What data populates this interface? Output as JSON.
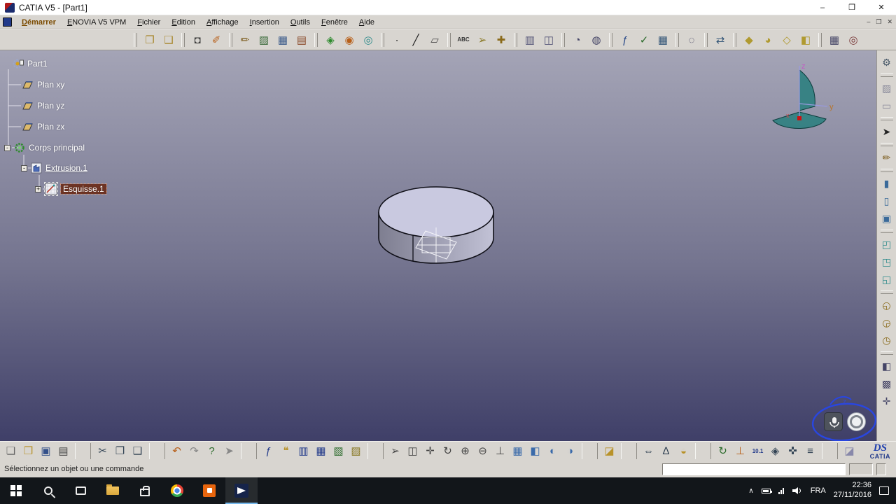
{
  "window": {
    "title": "CATIA V5 - [Part1]",
    "controls": [
      {
        "name": "minimize-button",
        "glyph": "–"
      },
      {
        "name": "maximize-button",
        "glyph": "❒"
      },
      {
        "name": "close-button",
        "glyph": "✕"
      }
    ],
    "mdi_controls": [
      {
        "name": "mdi-minimize-button",
        "glyph": "–"
      },
      {
        "name": "mdi-restore-button",
        "glyph": "❐"
      },
      {
        "name": "mdi-close-button",
        "glyph": "✕"
      }
    ]
  },
  "menu": {
    "items": [
      {
        "label": "Démarrer",
        "name": "menu-demarrer",
        "cls": "accent"
      },
      {
        "label": "ENOVIA V5 VPM",
        "name": "menu-enovia-v5-vpm"
      },
      {
        "label": "Fichier",
        "name": "menu-fichier"
      },
      {
        "label": "Edition",
        "name": "menu-edition"
      },
      {
        "label": "Affichage",
        "name": "menu-affichage"
      },
      {
        "label": "Insertion",
        "name": "menu-insertion"
      },
      {
        "label": "Outils",
        "name": "menu-outils"
      },
      {
        "label": "Fenêtre",
        "name": "menu-fenetre"
      },
      {
        "label": "Aide",
        "name": "menu-aide"
      }
    ]
  },
  "top_toolbar": {
    "icons": [
      {
        "cls": "sep",
        "name": "toolbar-handle"
      },
      {
        "name": "copy-view-icon",
        "glyph": "❐",
        "color": "#a8862a"
      },
      {
        "name": "paste-view-icon",
        "glyph": "❑",
        "color": "#a8862a"
      },
      {
        "cls": "sep",
        "name": "toolbar-handle"
      },
      {
        "name": "capture-icon",
        "glyph": "◘",
        "color": "#3a3a3a"
      },
      {
        "name": "paint-icon",
        "glyph": "✐",
        "color": "#b8601a"
      },
      {
        "cls": "sep",
        "name": "toolbar-handle"
      },
      {
        "name": "sketch-tracer-icon",
        "glyph": "✏",
        "color": "#7a5a1a"
      },
      {
        "name": "photo-studio-icon",
        "glyph": "▨",
        "color": "#3a6a3a"
      },
      {
        "name": "render-icon",
        "glyph": "▦",
        "color": "#3a5a8a"
      },
      {
        "name": "material-icon",
        "glyph": "▤",
        "color": "#8a4a2a"
      },
      {
        "cls": "sep",
        "name": "toolbar-handle"
      },
      {
        "name": "part-design-icon",
        "glyph": "◈",
        "color": "#2e8b2e"
      },
      {
        "name": "assembly-icon",
        "glyph": "◉",
        "color": "#b8601a"
      },
      {
        "name": "generative-shape-icon",
        "glyph": "◎",
        "color": "#2e8b8b"
      },
      {
        "cls": "sep",
        "name": "toolbar-handle"
      },
      {
        "name": "point-icon",
        "glyph": "∙",
        "color": "#1a1a1a"
      },
      {
        "name": "line-icon",
        "glyph": "╱",
        "color": "#1a1a1a"
      },
      {
        "name": "plane-tool-icon",
        "glyph": "▱",
        "color": "#4a4a4a"
      },
      {
        "cls": "sep",
        "name": "toolbar-handle"
      },
      {
        "name": "text-annotation-icon",
        "glyph": "ABC",
        "color": "#333333",
        "cls": "txt"
      },
      {
        "name": "flag-note-icon",
        "glyph": "➢",
        "color": "#887722"
      },
      {
        "name": "weld-feature-icon",
        "glyph": "✚",
        "color": "#8a6a1a"
      },
      {
        "cls": "sep",
        "name": "toolbar-handle"
      },
      {
        "name": "clash-icon",
        "glyph": "▥",
        "color": "#555577"
      },
      {
        "name": "sectioning-icon",
        "glyph": "◫",
        "color": "#555577"
      },
      {
        "cls": "sep",
        "name": "toolbar-handle"
      },
      {
        "name": "constraints-icon",
        "glyph": "◔",
        "color": "#444466"
      },
      {
        "name": "fix-constraint-icon",
        "glyph": "◍",
        "color": "#444466"
      },
      {
        "cls": "sep",
        "name": "toolbar-handle"
      },
      {
        "name": "formula-knowledge-icon",
        "glyph": "ƒ",
        "color": "#2a4a8a"
      },
      {
        "name": "check-icon",
        "glyph": "✓",
        "color": "#2a6a2a"
      },
      {
        "name": "design-table-icon",
        "glyph": "▦",
        "color": "#335577"
      },
      {
        "cls": "sep",
        "name": "toolbar-handle"
      },
      {
        "name": "search-icon",
        "glyph": "◌",
        "color": "#333355"
      },
      {
        "cls": "sep",
        "name": "toolbar-handle"
      },
      {
        "name": "exchange-icon",
        "glyph": "⇄",
        "color": "#335577"
      },
      {
        "cls": "sep",
        "name": "toolbar-handle"
      },
      {
        "name": "iso-view-icon",
        "glyph": "◆",
        "color": "#b09a30"
      },
      {
        "name": "shading-icon",
        "glyph": "◕",
        "color": "#b09a30"
      },
      {
        "name": "wireframe-view-icon",
        "glyph": "◇",
        "color": "#b09a30"
      },
      {
        "name": "cut-view-icon",
        "glyph": "◧",
        "color": "#b09a30"
      },
      {
        "cls": "sep",
        "name": "toolbar-handle"
      },
      {
        "name": "grid-icon",
        "glyph": "▦",
        "color": "#444466"
      },
      {
        "name": "target-icon",
        "glyph": "◎",
        "color": "#7a3a3a"
      }
    ]
  },
  "right_toolbar": {
    "icons": [
      {
        "name": "workbench-icon",
        "glyph": "⚙",
        "color": "#445566"
      },
      {
        "cls": "sep",
        "name": "toolbar-handle"
      },
      {
        "name": "render-style-icon",
        "glyph": "▨",
        "color": "#888899"
      },
      {
        "name": "ruler-icon",
        "glyph": "▭",
        "color": "#888899"
      },
      {
        "cls": "sep",
        "name": "toolbar-handle"
      },
      {
        "name": "select-arrow-icon",
        "glyph": "➤",
        "color": "#222222"
      },
      {
        "cls": "sep",
        "name": "toolbar-handle"
      },
      {
        "name": "sketcher-icon",
        "glyph": "✏",
        "color": "#7a5a1a"
      },
      {
        "cls": "sep",
        "name": "toolbar-handle"
      },
      {
        "name": "pad-icon",
        "glyph": "▮",
        "color": "#3a6a9a"
      },
      {
        "name": "pocket-icon",
        "glyph": "▯",
        "color": "#3a6a9a"
      },
      {
        "name": "shaft-icon",
        "glyph": "▣",
        "color": "#3a6a9a"
      },
      {
        "cls": "sep",
        "name": "toolbar-handle"
      },
      {
        "name": "shell-icon",
        "glyph": "◰",
        "color": "#2e8b8b"
      },
      {
        "name": "thickness-icon",
        "glyph": "◳",
        "color": "#2e8b8b"
      },
      {
        "name": "stiffener-icon",
        "glyph": "◱",
        "color": "#2e8b8b"
      },
      {
        "cls": "sep",
        "name": "toolbar-handle"
      },
      {
        "name": "fillet-icon",
        "glyph": "◵",
        "color": "#8a6a1a"
      },
      {
        "name": "chamfer-icon",
        "glyph": "◶",
        "color": "#8a6a1a"
      },
      {
        "name": "draft-icon",
        "glyph": "◷",
        "color": "#8a6a1a"
      },
      {
        "cls": "sep",
        "name": "toolbar-handle"
      },
      {
        "name": "mirror-icon",
        "glyph": "◧",
        "color": "#444466"
      },
      {
        "name": "pattern-icon",
        "glyph": "▩",
        "color": "#444466"
      },
      {
        "name": "measure-icon",
        "glyph": "✛",
        "color": "#444466"
      }
    ]
  },
  "bottom_toolbar": {
    "icons": [
      {
        "name": "new-document-icon",
        "glyph": "❏",
        "color": "#666666"
      },
      {
        "name": "open-icon",
        "glyph": "❒",
        "color": "#b8922a"
      },
      {
        "name": "save-icon",
        "glyph": "▣",
        "color": "#33508a"
      },
      {
        "name": "print-icon",
        "glyph": "▤",
        "color": "#444444"
      },
      {
        "cls": "sep",
        "name": "toolbar-handle"
      },
      {
        "name": "cut-icon",
        "glyph": "✂",
        "color": "#334455"
      },
      {
        "name": "copy-icon",
        "glyph": "❐",
        "color": "#334455"
      },
      {
        "name": "paste-icon",
        "glyph": "❑",
        "color": "#334455"
      },
      {
        "cls": "sep",
        "name": "toolbar-handle"
      },
      {
        "name": "undo-icon",
        "glyph": "↶",
        "color": "#b8601a"
      },
      {
        "name": "redo-icon",
        "glyph": "↷",
        "color": "#888888"
      },
      {
        "name": "help-icon",
        "glyph": "?",
        "color": "#2a6a2a"
      },
      {
        "name": "whats-this-icon",
        "glyph": "➤",
        "color": "#888888"
      },
      {
        "cls": "sep",
        "name": "toolbar-handle"
      },
      {
        "name": "formula-icon",
        "glyph": "ƒ",
        "color": "#223a8a"
      },
      {
        "name": "comment-icon",
        "glyph": "❝",
        "color": "#b8922a"
      },
      {
        "name": "rule-icon",
        "glyph": "▥",
        "color": "#223a8a"
      },
      {
        "name": "table-icon",
        "glyph": "▦",
        "color": "#223a8a"
      },
      {
        "name": "reactions-icon",
        "glyph": "▧",
        "color": "#2a6a2a"
      },
      {
        "name": "relations-icon",
        "glyph": "▨",
        "color": "#887722"
      },
      {
        "cls": "sep",
        "name": "toolbar-handle"
      },
      {
        "name": "fly-mode-icon",
        "glyph": "➢",
        "color": "#444444"
      },
      {
        "name": "fit-all-icon",
        "glyph": "◫",
        "color": "#444444"
      },
      {
        "name": "pan-icon",
        "glyph": "✛",
        "color": "#444444"
      },
      {
        "name": "rotate-icon",
        "glyph": "↻",
        "color": "#444444"
      },
      {
        "name": "zoom-in-icon",
        "glyph": "⊕",
        "color": "#444444"
      },
      {
        "name": "zoom-out-icon",
        "glyph": "⊖",
        "color": "#444444"
      },
      {
        "name": "normal-view-icon",
        "glyph": "⊥",
        "color": "#444444"
      },
      {
        "name": "multi-view-icon",
        "glyph": "▦",
        "color": "#3a6aaa"
      },
      {
        "name": "quick-view-icon",
        "glyph": "◧",
        "color": "#3a6aaa"
      },
      {
        "name": "hide-show-icon",
        "glyph": "◐",
        "color": "#3a6aaa"
      },
      {
        "name": "swap-space-icon",
        "glyph": "◑",
        "color": "#3a6aaa"
      },
      {
        "cls": "sep",
        "name": "toolbar-handle"
      },
      {
        "name": "catalog-icon",
        "glyph": "◪",
        "color": "#b8922a"
      },
      {
        "cls": "sep",
        "name": "toolbar-handle"
      },
      {
        "name": "measure-between-icon",
        "glyph": "⇔",
        "color": "#334455"
      },
      {
        "name": "measure-item-icon",
        "glyph": "∆",
        "color": "#334455"
      },
      {
        "name": "mass-properties-icon",
        "glyph": "◒",
        "color": "#b8922a"
      },
      {
        "cls": "sep",
        "name": "toolbar-handle"
      },
      {
        "name": "update-icon",
        "glyph": "↻",
        "color": "#2a6a2a"
      },
      {
        "name": "axis-system-icon",
        "glyph": "⊥",
        "color": "#b8601a"
      },
      {
        "name": "mean-dimension-icon",
        "glyph": "10.1",
        "color": "#223a8a",
        "cls": "txt"
      },
      {
        "name": "only-current-body-icon",
        "glyph": "◈",
        "color": "#334455"
      },
      {
        "name": "manipulation-icon",
        "glyph": "✜",
        "color": "#334455"
      },
      {
        "name": "selection-list-icon",
        "glyph": "≡",
        "color": "#334455"
      },
      {
        "cls": "sep",
        "name": "toolbar-handle"
      },
      {
        "name": "eraser-icon",
        "glyph": "◪",
        "color": "#8888aa"
      }
    ]
  },
  "tree": {
    "items": [
      {
        "label": "Part1"
      },
      {
        "label": "Plan xy"
      },
      {
        "label": "Plan yz"
      },
      {
        "label": "Plan zx"
      },
      {
        "label": "Corps principal",
        "expander": "-"
      },
      {
        "label": "Extrusion.1",
        "expander": "-"
      },
      {
        "label": "Esquisse.1",
        "expander": "+"
      }
    ]
  },
  "compass": {
    "x": "x",
    "y": "y",
    "z": "z"
  },
  "annotation": {
    "label": "z"
  },
  "status_bar": {
    "message": "Sélectionnez un objet ou une commande",
    "command_value": ""
  },
  "logo": {
    "ds": "DS",
    "catia": "CATIA"
  },
  "taskbar": {
    "language": "FRA",
    "time": "22:36",
    "date": "27/11/2016",
    "apps": [
      "start",
      "search",
      "task-view",
      "file-explorer",
      "store",
      "chrome",
      "orange-app",
      "catia"
    ]
  },
  "colors": {
    "vp-top": "#a4a4b6",
    "vp-mid": "#74748f",
    "vp-bot": "#3f3f68",
    "selection": "#6e3424",
    "annotation": "#2946e0"
  }
}
